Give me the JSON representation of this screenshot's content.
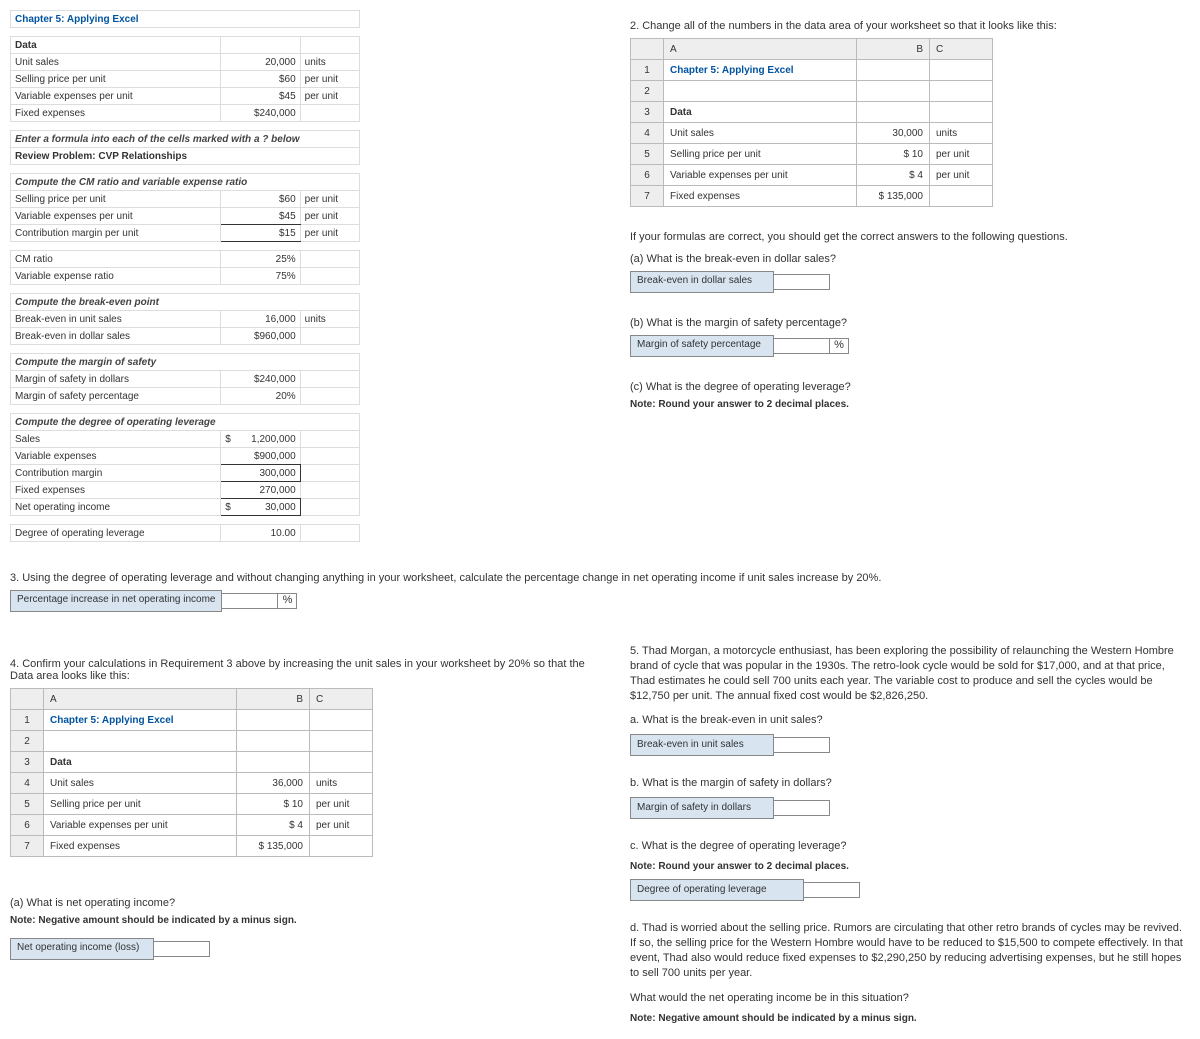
{
  "left_ws": {
    "title": "Chapter 5: Applying Excel",
    "data_hdr": "Data",
    "r1": {
      "lab": "Unit sales",
      "val": "20,000",
      "unit": "units"
    },
    "r2": {
      "lab": "Selling price per unit",
      "val": "$60",
      "unit": "per unit"
    },
    "r3": {
      "lab": "Variable expenses per unit",
      "val": "$45",
      "unit": "per unit"
    },
    "r4": {
      "lab": "Fixed expenses",
      "val": "$240,000",
      "unit": ""
    },
    "instr1": "Enter a formula into each of the cells marked with a ? below",
    "instr2": "Review Problem: CVP Relationships",
    "sec1_hdr": "Compute the CM ratio and variable expense ratio",
    "s1r1": {
      "lab": "Selling price per unit",
      "val": "$60",
      "unit": "per unit"
    },
    "s1r2": {
      "lab": "Variable expenses per unit",
      "val": "$45",
      "unit": "per unit"
    },
    "s1r3": {
      "lab": "Contribution margin per unit",
      "val": "$15",
      "unit": "per unit"
    },
    "s1r4": {
      "lab": "CM ratio",
      "val": "25%",
      "unit": ""
    },
    "s1r5": {
      "lab": "Variable expense ratio",
      "val": "75%",
      "unit": ""
    },
    "sec2_hdr": "Compute the break-even point",
    "s2r1": {
      "lab": "Break-even in unit sales",
      "val": "16,000",
      "unit": "units"
    },
    "s2r2": {
      "lab": "Break-even in dollar sales",
      "val": "$960,000",
      "unit": ""
    },
    "sec3_hdr": "Compute the margin of safety",
    "s3r1": {
      "lab": "Margin of safety in dollars",
      "val": "$240,000",
      "unit": ""
    },
    "s3r2": {
      "lab": "Margin of safety percentage",
      "val": "20%",
      "unit": ""
    },
    "sec4_hdr": "Compute the degree of operating leverage",
    "s4r1": {
      "lab": "Sales",
      "pre": "$",
      "val": "1,200,000",
      "unit": ""
    },
    "s4r2": {
      "lab": "Variable expenses",
      "val": "$900,000",
      "unit": ""
    },
    "s4r3": {
      "lab": "Contribution margin",
      "val": "300,000",
      "unit": ""
    },
    "s4r4": {
      "lab": "Fixed expenses",
      "val": "270,000",
      "unit": ""
    },
    "s4r5": {
      "lab": "Net operating income",
      "pre": "$",
      "val": "30,000",
      "unit": ""
    },
    "s4r6": {
      "lab": "Degree of operating leverage",
      "val": "10.00",
      "unit": ""
    }
  },
  "right": {
    "q2": "2. Change all of the numbers in the data area of your worksheet so that it looks like this:",
    "table2": {
      "colA": "A",
      "colB": "B",
      "colC": "C",
      "r1": {
        "n": "1",
        "a": "Chapter 5: Applying Excel",
        "b": "",
        "c": ""
      },
      "r2": {
        "n": "2",
        "a": "",
        "b": "",
        "c": ""
      },
      "r3": {
        "n": "3",
        "a": "Data",
        "b": "",
        "c": ""
      },
      "r4": {
        "n": "4",
        "a": "Unit sales",
        "b": "30,000",
        "c": "units"
      },
      "r5": {
        "n": "5",
        "a": "Selling price per unit",
        "b": "$         10",
        "c": "per unit"
      },
      "r6": {
        "n": "6",
        "a": "Variable expenses per unit",
        "b": "$           4",
        "c": "per unit"
      },
      "r7": {
        "n": "7",
        "a": "Fixed expenses",
        "b": "$ 135,000",
        "c": ""
      }
    },
    "formulas_ok": "If your formulas are correct, you should get the correct answers to the following questions.",
    "qa": "(a) What is the break-even in dollar sales?",
    "ans_a_label": "Break-even in dollar sales",
    "qb": "(b) What is the margin of safety percentage?",
    "ans_b_label": "Margin of safety percentage",
    "ans_b_unit": "%",
    "qc": "(c) What is the degree of operating leverage?",
    "qc_note": "Note: Round your answer to 2 decimal places."
  },
  "q3": {
    "text": "3. Using the degree of operating leverage and without changing anything in your worksheet, calculate the percentage change in net operating income if unit sales increase by 20%.",
    "label": "Percentage increase in net operating income",
    "unit": "%"
  },
  "q4": {
    "text": "4. Confirm your calculations in Requirement 3 above by increasing the unit sales in your worksheet by 20% so that the Data area looks like this:",
    "table": {
      "colA": "A",
      "colB": "B",
      "colC": "C",
      "r1": {
        "n": "1",
        "a": "Chapter 5: Applying Excel",
        "b": "",
        "c": ""
      },
      "r2": {
        "n": "2",
        "a": "",
        "b": "",
        "c": ""
      },
      "r3": {
        "n": "3",
        "a": "Data",
        "b": "",
        "c": ""
      },
      "r4": {
        "n": "4",
        "a": "Unit sales",
        "b": "36,000",
        "c": "units"
      },
      "r5": {
        "n": "5",
        "a": "Selling price per unit",
        "b": "$         10",
        "c": "per unit"
      },
      "r6": {
        "n": "6",
        "a": "Variable expenses per unit",
        "b": "$           4",
        "c": "per unit"
      },
      "r7": {
        "n": "7",
        "a": "Fixed expenses",
        "b": "$ 135,000",
        "c": ""
      }
    },
    "qa": "(a) What is net operating income?",
    "qa_note": "Note: Negative amount should be indicated by a minus sign.",
    "qa_label": "Net operating income (loss)"
  },
  "q5": {
    "intro": "5. Thad Morgan, a motorcycle enthusiast, has been exploring the possibility of relaunching the Western Hombre brand of cycle that was popular in the 1930s. The retro-look cycle would be sold for $17,000, and at that price, Thad estimates he could sell 700 units each year. The variable cost to produce and sell the cycles would be $12,750 per unit. The annual fixed cost would be $2,826,250.",
    "a": "a. What is the break-even in unit sales?",
    "a_label": "Break-even in unit sales",
    "b": "b. What is the margin of safety in dollars?",
    "b_label": "Margin of safety in dollars",
    "c": "c. What is the degree of operating leverage?",
    "c_note": "Note: Round your answer to 2 decimal places.",
    "c_label": "Degree of operating leverage",
    "d": "d. Thad is worried about the selling price. Rumors are circulating that other retro brands of cycles may be revived. If so, the selling price for the Western Hombre would have to be reduced to $15,500 to compete effectively. In that event, Thad also would reduce fixed expenses to $2,290,250 by reducing advertising expenses, but he still hopes to sell 700 units per year.",
    "d2": "What would the net operating income be in this situation?",
    "d_note": "Note: Negative amount should be indicated by a minus sign."
  }
}
